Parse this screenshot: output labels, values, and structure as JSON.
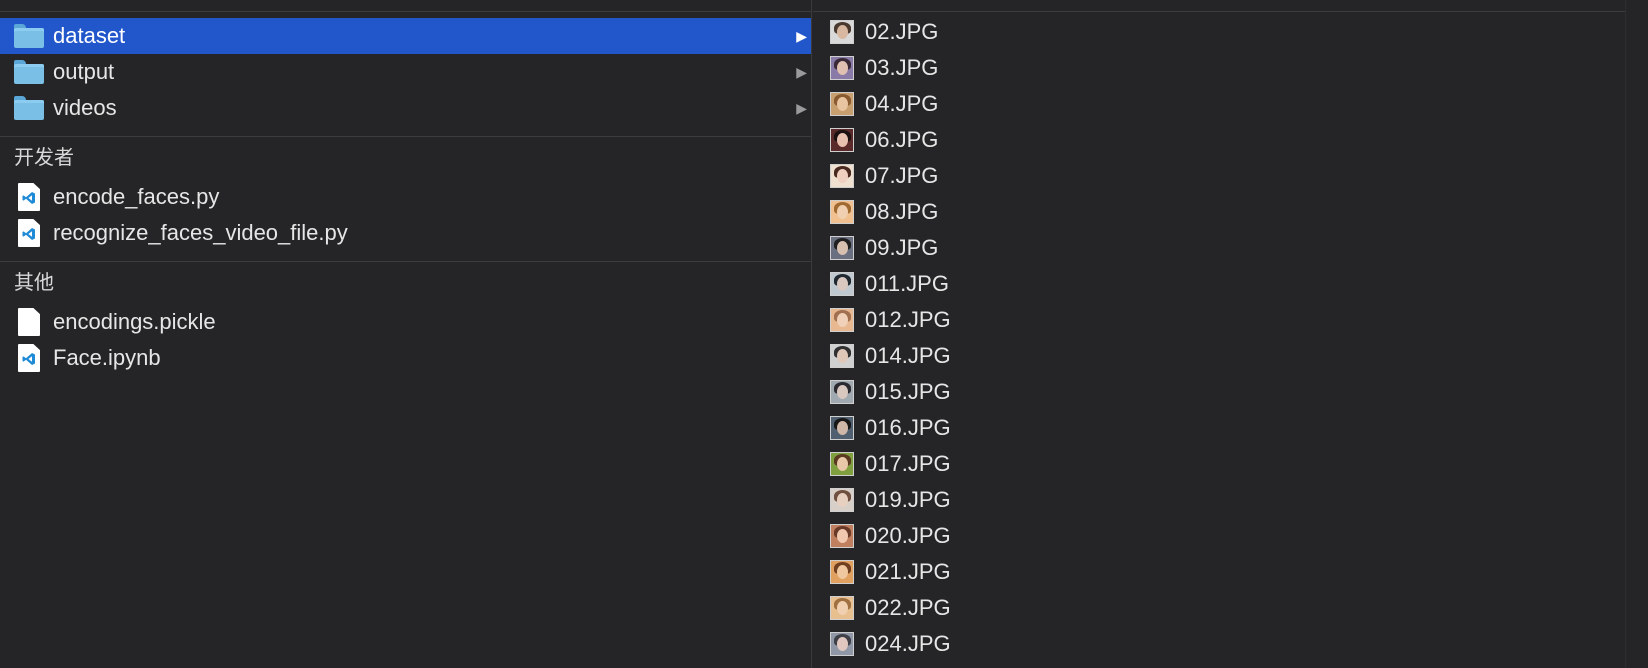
{
  "left_column": {
    "header_ghost": "",
    "folders": [
      {
        "label": "dataset",
        "selected": true,
        "icon": "folder-icon"
      },
      {
        "label": "output",
        "selected": false,
        "icon": "folder-icon"
      },
      {
        "label": "videos",
        "selected": false,
        "icon": "folder-icon"
      }
    ],
    "sections": [
      {
        "title": "开发者",
        "items": [
          {
            "label": "encode_faces.py",
            "icon": "vscode-file-icon"
          },
          {
            "label": "recognize_faces_video_file.py",
            "icon": "vscode-file-icon"
          }
        ]
      },
      {
        "title": "其他",
        "items": [
          {
            "label": "encodings.pickle",
            "icon": "blank-file-icon"
          },
          {
            "label": "Face.ipynb",
            "icon": "vscode-file-icon"
          }
        ]
      }
    ]
  },
  "right_column": {
    "files": [
      {
        "label": "02.JPG",
        "bg": "#d9d9d9",
        "hair": "#4a3a30",
        "skin": "#d8b8a0"
      },
      {
        "label": "03.JPG",
        "bg": "#8a7aa8",
        "hair": "#3a2a38",
        "skin": "#e0c0b0"
      },
      {
        "label": "04.JPG",
        "bg": "#c8a070",
        "hair": "#8a5a30",
        "skin": "#e8c4a0"
      },
      {
        "label": "06.JPG",
        "bg": "#5a2a2a",
        "hair": "#1a1010",
        "skin": "#e8c0b0"
      },
      {
        "label": "07.JPG",
        "bg": "#f0e0d0",
        "hair": "#4a2a20",
        "skin": "#f0d0c0"
      },
      {
        "label": "08.JPG",
        "bg": "#f0c090",
        "hair": "#a06a30",
        "skin": "#f0d0b0"
      },
      {
        "label": "09.JPG",
        "bg": "#6a7080",
        "hair": "#202020",
        "skin": "#d8c0b0"
      },
      {
        "label": "011.JPG",
        "bg": "#c0c8d0",
        "hair": "#202830",
        "skin": "#d8c8c0"
      },
      {
        "label": "012.JPG",
        "bg": "#e8b890",
        "hair": "#a07050",
        "skin": "#f0d0b8"
      },
      {
        "label": "014.JPG",
        "bg": "#d0d0d0",
        "hair": "#303030",
        "skin": "#e0c8b8"
      },
      {
        "label": "015.JPG",
        "bg": "#a0a8b0",
        "hair": "#2a2a30",
        "skin": "#d8c8c0"
      },
      {
        "label": "016.JPG",
        "bg": "#506070",
        "hair": "#181818",
        "skin": "#d0b8a8"
      },
      {
        "label": "017.JPG",
        "bg": "#80a040",
        "hair": "#5a3a20",
        "skin": "#e8c8a8"
      },
      {
        "label": "019.JPG",
        "bg": "#d8d0c8",
        "hair": "#705040",
        "skin": "#e8d0c0"
      },
      {
        "label": "020.JPG",
        "bg": "#c08060",
        "hair": "#6a3a28",
        "skin": "#f0c8b0"
      },
      {
        "label": "021.JPG",
        "bg": "#e0a060",
        "hair": "#704020",
        "skin": "#f0c8a0"
      },
      {
        "label": "022.JPG",
        "bg": "#e8c090",
        "hair": "#a07040",
        "skin": "#f0d0b0"
      },
      {
        "label": "024.JPG",
        "bg": "#9098a8",
        "hair": "#404048",
        "skin": "#e0c8c0"
      }
    ]
  },
  "colors": {
    "selection": "#2257cc",
    "background": "#252527",
    "folder": "#79bfe6"
  }
}
